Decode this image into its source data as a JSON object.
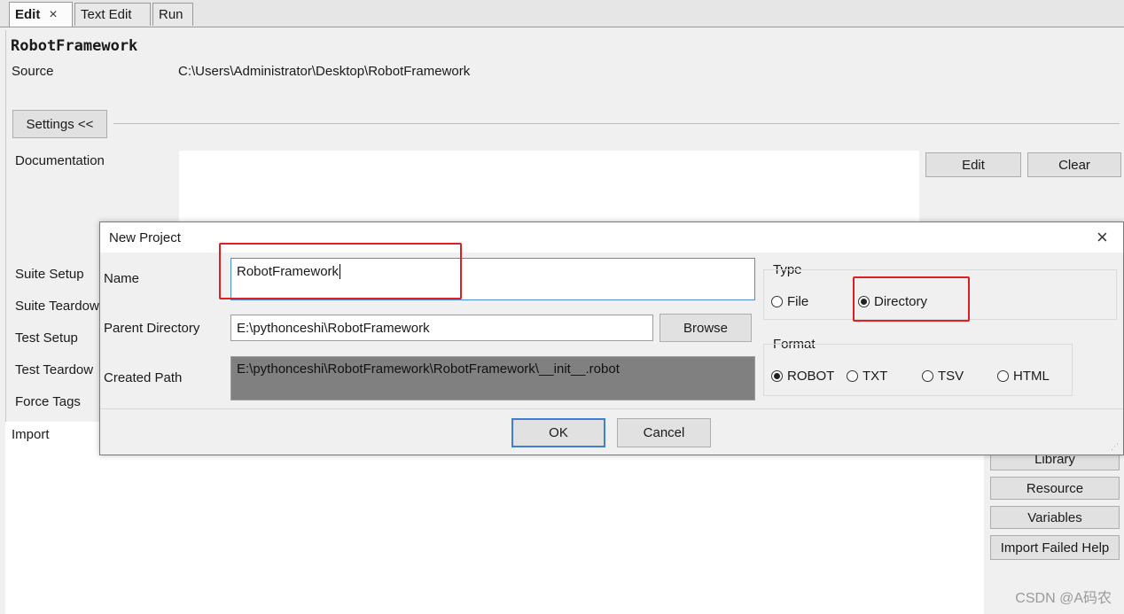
{
  "tabs": [
    {
      "label": "Edit",
      "active": true,
      "close": "×"
    },
    {
      "label": "Text Edit"
    },
    {
      "label": "Run"
    }
  ],
  "suite": {
    "title": "RobotFramework",
    "source_label": "Source",
    "source_value": "C:\\Users\\Administrator\\Desktop\\RobotFramework"
  },
  "settings": {
    "toggle_label": "Settings <<",
    "documentation_label": "Documentation",
    "edit_label": "Edit",
    "clear_label": "Clear",
    "suite_setup_label": "Suite Setup",
    "suite_teardown_label": "Suite Teardow",
    "test_setup_label": "Test Setup",
    "test_teardown_label": "Test Teardow",
    "force_tags_label": "Force Tags"
  },
  "import": {
    "label": "Import",
    "buttons": [
      "Library",
      "Resource",
      "Variables",
      "Import Failed Help"
    ]
  },
  "dialog": {
    "title": "New Project",
    "close_icon": "×",
    "name_label": "Name",
    "name_value": "RobotFramework",
    "parent_label": "Parent Directory",
    "parent_value": "E:\\pythonceshi\\RobotFramework",
    "browse_label": "Browse",
    "created_label": "Created Path",
    "created_value": "E:\\pythonceshi\\RobotFramework\\RobotFramework\\__init__.robot",
    "type_label": "Type",
    "type_options": [
      "File",
      "Directory"
    ],
    "type_selected": "Directory",
    "format_label": "Format",
    "format_options": [
      "ROBOT",
      "TXT",
      "TSV",
      "HTML"
    ],
    "format_selected": "ROBOT",
    "ok_label": "OK",
    "cancel_label": "Cancel"
  },
  "watermark": "CSDN @A码农",
  "colors": {
    "highlight": "#e02020",
    "created_path_bg": "#808080",
    "focus_border": "#4a90d9"
  }
}
